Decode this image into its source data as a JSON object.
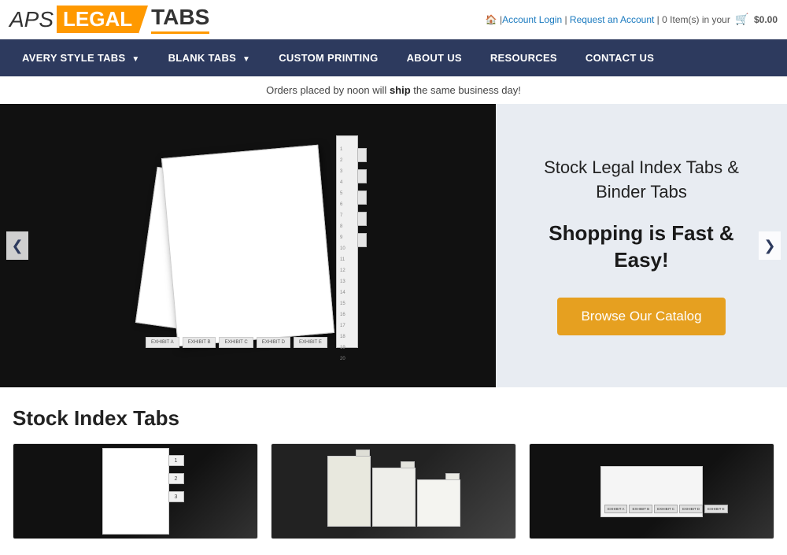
{
  "topbar": {
    "logo_aps": "APS",
    "logo_legal": "LEGAL",
    "logo_tabs": "TABS",
    "home_icon": "🏠",
    "account_login": "Account Login",
    "request_account": "Request an Account",
    "cart_items": "0 Item(s) in your",
    "cart_icon": "🛒",
    "cart_total": "$0.00"
  },
  "nav": {
    "items": [
      {
        "label": "AVERY STYLE TABS",
        "has_arrow": true
      },
      {
        "label": "BLANK TABS",
        "has_arrow": true
      },
      {
        "label": "CUSTOM PRINTING",
        "has_arrow": false
      },
      {
        "label": "ABOUT US",
        "has_arrow": false
      },
      {
        "label": "RESOURCES",
        "has_arrow": false
      },
      {
        "label": "CONTACT US",
        "has_arrow": false
      }
    ]
  },
  "announcement": {
    "prefix": "Orders placed by noon will",
    "bold": "ship",
    "suffix": "the same business day!"
  },
  "hero": {
    "title": "Stock Legal Index Tabs & Binder Tabs",
    "subtitle": "Shopping is Fast & Easy!",
    "browse_btn": "Browse Our Catalog",
    "prev_arrow": "❮",
    "next_arrow": "❯"
  },
  "stock": {
    "section_title": "Stock Index Tabs",
    "items": [
      {
        "alt": "Numbered index tabs"
      },
      {
        "alt": "White divider tabs"
      },
      {
        "alt": "Exhibit label tabs"
      }
    ]
  },
  "bottom_tabs": [
    "EXHIBIT A",
    "EXHIBIT B",
    "EXHIBIT C",
    "EXHIBIT D",
    "EXHIBIT E"
  ],
  "exhibit_tabs": [
    "EXHIBIT A",
    "EXHIBIT B",
    "EXHIBIT C",
    "EXHIBIT D",
    "EXHIBIT E"
  ]
}
